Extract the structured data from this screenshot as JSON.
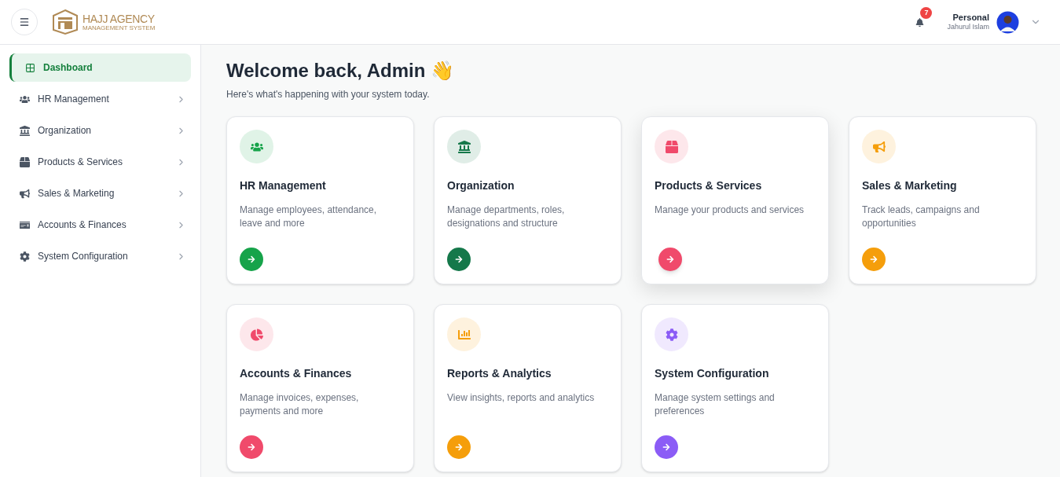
{
  "header": {
    "logo": {
      "title": "HAJJ AGENCY",
      "subtitle": "MANAGEMENT SYSTEM"
    },
    "notifications": {
      "count": "7"
    },
    "user": {
      "role": "Personal",
      "name": "Jahurul Islam"
    }
  },
  "sidebar": {
    "items": [
      {
        "label": "Dashboard",
        "kind": "grid",
        "selected": true,
        "expandable": false
      },
      {
        "label": "HR Management",
        "kind": "users",
        "selected": false,
        "expandable": true
      },
      {
        "label": "Organization",
        "kind": "bank",
        "selected": false,
        "expandable": true
      },
      {
        "label": "Products & Services",
        "kind": "box",
        "selected": false,
        "expandable": true
      },
      {
        "label": "Sales & Marketing",
        "kind": "bullhorn",
        "selected": false,
        "expandable": true
      },
      {
        "label": "Accounts & Finances",
        "kind": "check",
        "selected": false,
        "expandable": true
      },
      {
        "label": "System Configuration",
        "kind": "gear",
        "selected": false,
        "expandable": true
      }
    ]
  },
  "main": {
    "title": "Welcome back, Admin 👋",
    "subtitle": "Here's what's happening with your system today.",
    "cards": [
      {
        "title": "HR Management",
        "description": "Manage employees, attendance, leave and more",
        "kind": "users",
        "color": "#16a34a",
        "hovered": false
      },
      {
        "title": "Organization",
        "description": "Manage departments, roles, designations and structure",
        "kind": "bank",
        "color": "#15784a",
        "hovered": false
      },
      {
        "title": "Products & Services",
        "description": "Manage your products and services",
        "kind": "box",
        "color": "#f04a6b",
        "hovered": true
      },
      {
        "title": "Sales & Marketing",
        "description": "Track leads, campaigns and opportunities",
        "kind": "bullhorn",
        "color": "#f59e0b",
        "hovered": false
      },
      {
        "title": "Accounts & Finances",
        "description": "Manage invoices, expenses, payments and more",
        "kind": "pie",
        "color": "#f04a6b",
        "hovered": false
      },
      {
        "title": "Reports & Analytics",
        "description": "View insights, reports and analytics",
        "kind": "bars",
        "color": "#f59e0b",
        "hovered": false
      },
      {
        "title": "System Configuration",
        "description": "Manage system settings and preferences",
        "kind": "gear",
        "color": "#8b5cf6",
        "hovered": false
      }
    ]
  }
}
